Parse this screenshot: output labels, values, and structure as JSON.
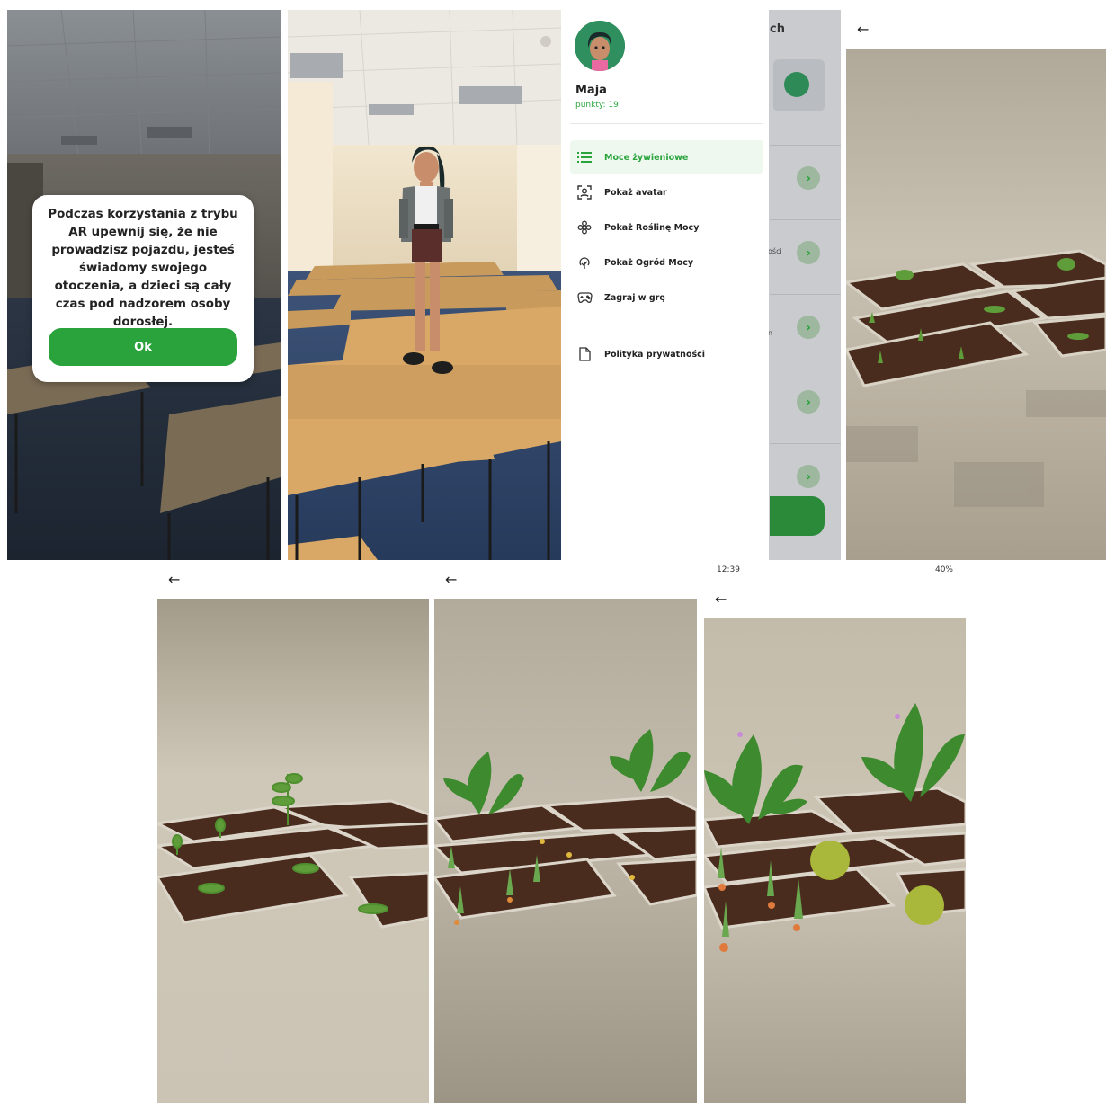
{
  "panel1": {
    "dialog_text": "Podczas korzystania z trybu AR upewnij się, że nie prowadzisz pojazdu, jesteś świadomy swojego otoczenia, a dzieci są cały czas pod nadzorem osoby dorosłej.",
    "ok_label": "Ok"
  },
  "panel3": {
    "user_name": "Maja",
    "user_points": "punkty: 19",
    "menu": [
      {
        "label": "Moce żywieniowe",
        "icon": "list-icon",
        "active": true
      },
      {
        "label": "Pokaż avatar",
        "icon": "avatar-scan-icon",
        "active": false
      },
      {
        "label": "Pokaż Roślinę Mocy",
        "icon": "flower-icon",
        "active": false
      },
      {
        "label": "Pokaż Ogród Mocy",
        "icon": "tree-icon",
        "active": false
      },
      {
        "label": "Zagraj w grę",
        "icon": "gamepad-icon",
        "active": false
      }
    ],
    "privacy_label": "Polityka prywatności",
    "bg_title_fragment": "ch",
    "bg_text_1": "ości",
    "bg_text_2": "n"
  },
  "panel7": {
    "status_time": "12:39",
    "status_right": "40%"
  },
  "colors": {
    "accent": "#2aa33d",
    "dialog_bg": "#ffffff"
  }
}
